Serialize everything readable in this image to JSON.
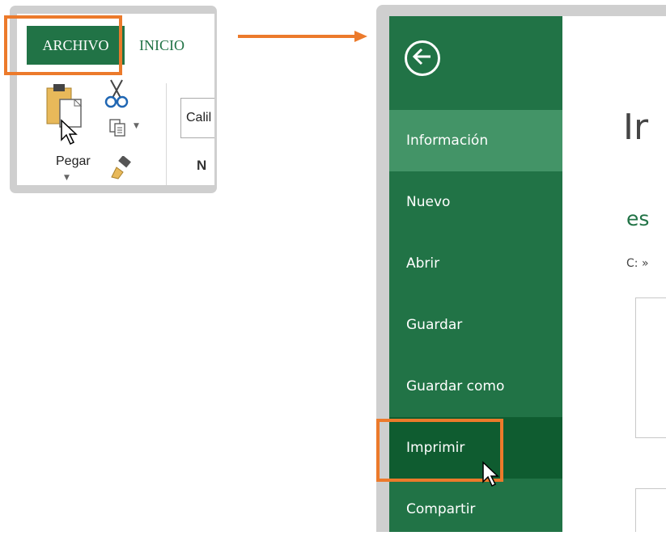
{
  "ribbon": {
    "tabs": [
      {
        "label": "ARCHIVO",
        "active": true
      },
      {
        "label": "INICIO",
        "active": false
      }
    ],
    "paste_label": "Pegar",
    "font_name": "Calil",
    "bold_label": "N"
  },
  "backstage": {
    "menu": [
      {
        "label": "Información",
        "state": "selected"
      },
      {
        "label": "Nuevo",
        "state": "normal"
      },
      {
        "label": "Abrir",
        "state": "normal"
      },
      {
        "label": "Guardar",
        "state": "normal"
      },
      {
        "label": "Guardar como",
        "state": "normal"
      },
      {
        "label": "Imprimir",
        "state": "hover"
      },
      {
        "label": "Compartir",
        "state": "normal"
      }
    ]
  },
  "content": {
    "title": "Ir",
    "subtitle": "es",
    "path": "C: »"
  },
  "colors": {
    "excel_green": "#217346",
    "selected_green": "#439467",
    "hover_green": "#0f5c30",
    "highlight_orange": "#ec7a2b",
    "frame_gray": "#cfcfcf"
  },
  "icons": [
    "paste-icon",
    "cut-icon",
    "copy-icon",
    "format-painter-icon",
    "back-arrow-icon",
    "mouse-cursor-icon"
  ]
}
